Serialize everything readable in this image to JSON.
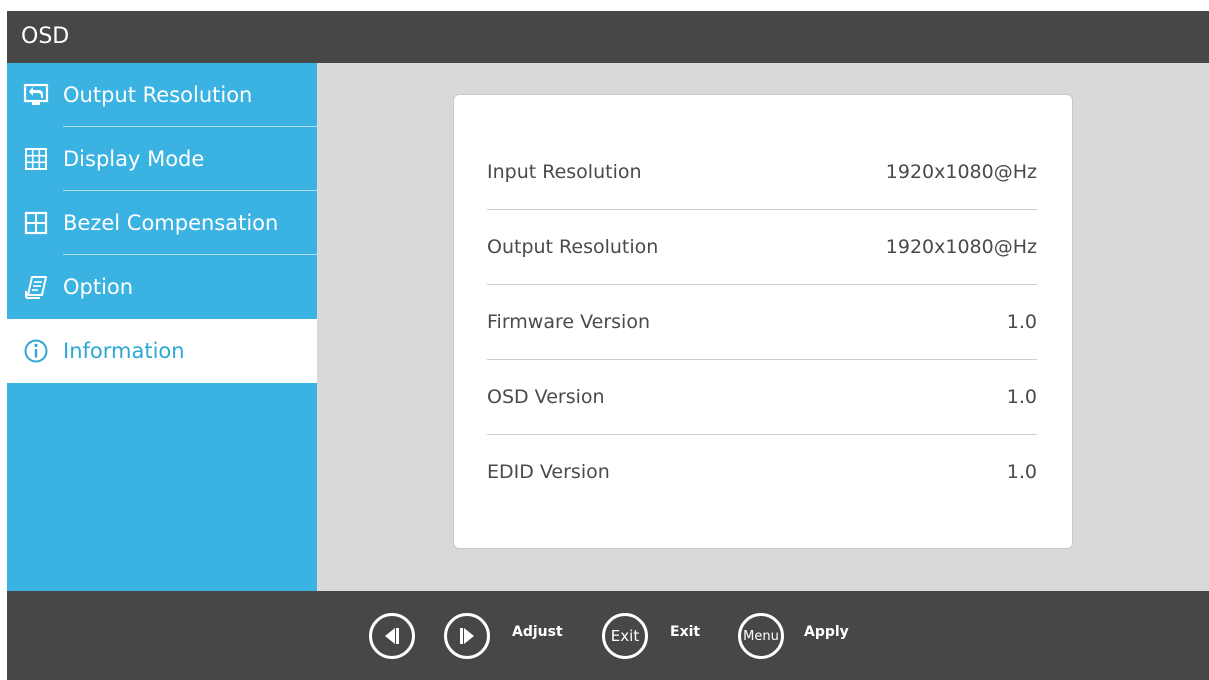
{
  "window": {
    "title": "OSD"
  },
  "sidebar": {
    "items": [
      {
        "label": "Output Resolution",
        "icon": "output-resolution-icon"
      },
      {
        "label": "Display Mode",
        "icon": "grid-icon"
      },
      {
        "label": "Bezel Compensation",
        "icon": "bezel-icon"
      },
      {
        "label": "Option",
        "icon": "document-icon"
      },
      {
        "label": "Information",
        "icon": "info-icon",
        "active": true
      }
    ]
  },
  "info": {
    "rows": [
      {
        "label": "Input Resolution",
        "value": "1920x1080@Hz"
      },
      {
        "label": "Output Resolution",
        "value": "1920x1080@Hz"
      },
      {
        "label": "Firmware Version",
        "value": "1.0"
      },
      {
        "label": "OSD Version",
        "value": "1.0"
      },
      {
        "label": "EDID Version",
        "value": "1.0"
      }
    ]
  },
  "hints": {
    "left_icon": "triangle-left-icon",
    "right_icon": "triangle-right-icon",
    "adjust_label": "Adjust",
    "exit_button": "Exit",
    "exit_label": "Exit",
    "menu_button": "Menu",
    "apply_label": "Apply"
  },
  "colors": {
    "accent": "#3ab2e2",
    "bar": "#474747",
    "content_bg": "#d9d9d9"
  }
}
